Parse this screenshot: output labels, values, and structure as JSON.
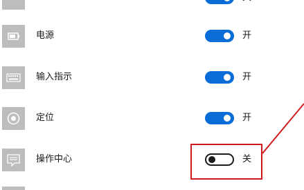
{
  "settings": {
    "items": [
      {
        "label": "",
        "icon": "partial-icon",
        "state": "关",
        "on": true
      },
      {
        "label": "电源",
        "icon": "battery-icon",
        "state": "开",
        "on": true
      },
      {
        "label": "输入指示",
        "icon": "keyboard-icon",
        "state": "开",
        "on": true
      },
      {
        "label": "定位",
        "icon": "location-icon",
        "state": "开",
        "on": true
      },
      {
        "label": "操作中心",
        "icon": "action-center-icon",
        "state": "关",
        "on": false
      }
    ]
  },
  "colors": {
    "accent": "#0a6cd6",
    "highlight": "#d0191f",
    "icon_bg": "#bdbdbd"
  }
}
